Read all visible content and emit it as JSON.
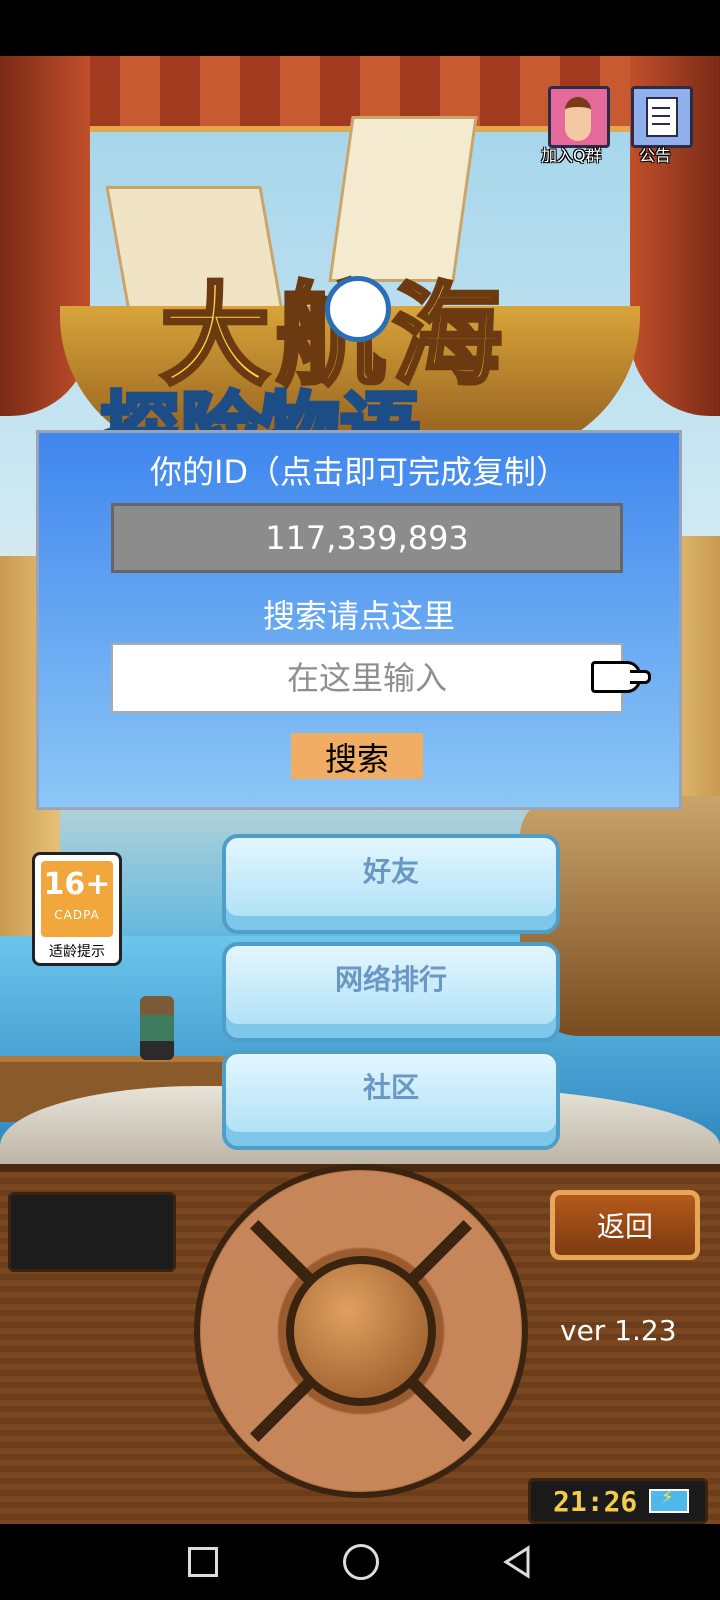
{
  "header": {
    "qq_group_label": "加入Q群",
    "notice_label": "公告"
  },
  "dialog": {
    "id_title": "你的ID（点击即可完成复制）",
    "id_value": "117,339,893",
    "search_title": "搜索请点这里",
    "search_placeholder": "在这里输入",
    "search_button": "搜索"
  },
  "menu": {
    "friends": "好友",
    "ranking": "网络排行",
    "community": "社区"
  },
  "age_rating": {
    "age": "16+",
    "org": "CADPA",
    "tip": "适龄提示"
  },
  "controls": {
    "back_label": "返回",
    "version": "ver 1.23",
    "clock": "21:26"
  },
  "icons": {
    "qq_group": "girl-avatar-icon",
    "notice": "document-icon",
    "search_pointer": "pointing-hand-icon",
    "nav_recent": "square-icon",
    "nav_home": "circle-icon",
    "nav_back": "triangle-back-icon",
    "battery": "battery-charging-icon"
  },
  "colors": {
    "panel_top": "#3f86ee",
    "panel_bottom": "#8cc7f6",
    "search_button": "#f0ad63",
    "id_box": "#8c8c8c",
    "clock_text": "#f3cc4d"
  }
}
